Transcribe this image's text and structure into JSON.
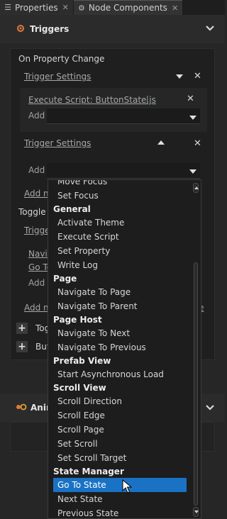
{
  "tabs": [
    {
      "label": "Properties",
      "icon": "list-icon",
      "close": "✕"
    },
    {
      "label": "Node Components",
      "icon": "components-icon",
      "close": "✕"
    }
  ],
  "triggers_section": {
    "title": "Triggers",
    "icon": "gear-icon"
  },
  "panel": {
    "trigger_name": "On Property Change",
    "trigger_settings_1": "Trigger Settings",
    "action_label": "Execute Script: ButtonState.js",
    "add_label_1": "Add",
    "trigger_settings_2": "Trigger Settings",
    "add_label_2": "Add",
    "add_node_1": "Add no",
    "toggle_label": "Toggle I",
    "trigger_partial": "Trigge",
    "navig_partial": "Navig",
    "goto_partial": "Go To",
    "add_label_3": "Add",
    "add_node_2": "Add no",
    "add_node_2_tail": "e",
    "tog_partial": "Tog",
    "but_partial": "But"
  },
  "animations_section": {
    "title": "Anim",
    "icon": "animation-icon"
  },
  "dropdown": {
    "items": [
      {
        "label": "Move Focus",
        "kind": "item"
      },
      {
        "label": "Set Focus",
        "kind": "item"
      },
      {
        "label": "General",
        "kind": "group"
      },
      {
        "label": "Activate Theme",
        "kind": "item"
      },
      {
        "label": "Execute Script",
        "kind": "item"
      },
      {
        "label": "Set Property",
        "kind": "item"
      },
      {
        "label": "Write Log",
        "kind": "item"
      },
      {
        "label": "Page",
        "kind": "group"
      },
      {
        "label": "Navigate To Page",
        "kind": "item"
      },
      {
        "label": "Navigate To Parent",
        "kind": "item"
      },
      {
        "label": "Page Host",
        "kind": "group"
      },
      {
        "label": "Navigate To Next",
        "kind": "item"
      },
      {
        "label": "Navigate To Previous",
        "kind": "item"
      },
      {
        "label": "Prefab View",
        "kind": "group"
      },
      {
        "label": "Start Asynchronous Load",
        "kind": "item"
      },
      {
        "label": "Scroll View",
        "kind": "group"
      },
      {
        "label": "Scroll Direction",
        "kind": "item"
      },
      {
        "label": "Scroll Edge",
        "kind": "item"
      },
      {
        "label": "Scroll Page",
        "kind": "item"
      },
      {
        "label": "Set Scroll",
        "kind": "item"
      },
      {
        "label": "Set Scroll Target",
        "kind": "item"
      },
      {
        "label": "State Manager",
        "kind": "group"
      },
      {
        "label": "Go To State",
        "kind": "selected"
      },
      {
        "label": "Next State",
        "kind": "item"
      },
      {
        "label": "Previous State",
        "kind": "item"
      }
    ]
  },
  "colors": {
    "accent": "#1a72c5",
    "panel_bg": "#1f1f1f",
    "app_bg": "#262626"
  }
}
